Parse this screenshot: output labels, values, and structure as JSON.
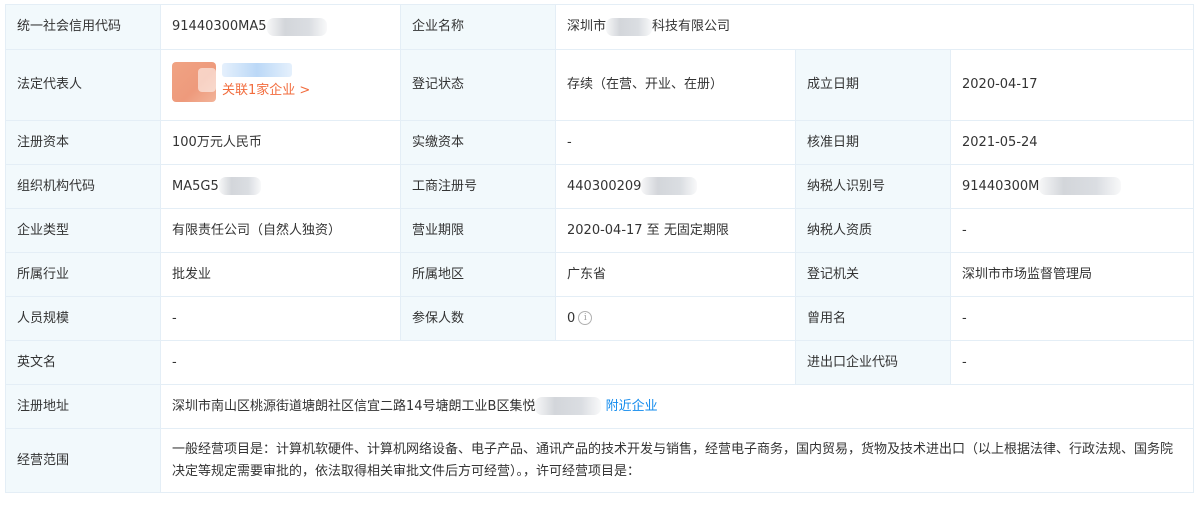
{
  "rows": {
    "r1": {
      "label1": "统一社会信用代码",
      "value1": "91440300MA5",
      "label2": "企业名称",
      "value2_prefix": "深圳市",
      "value2_suffix": "科技有限公司"
    },
    "r2": {
      "label1": "法定代表人",
      "rep_link": "关联1家企业 >",
      "label2": "登记状态",
      "value2": "存续（在营、开业、在册）",
      "label3": "成立日期",
      "value3": "2020-04-17"
    },
    "r3": {
      "label1": "注册资本",
      "value1": "100万元人民币",
      "label2": "实缴资本",
      "value2": "-",
      "label3": "核准日期",
      "value3": "2021-05-24"
    },
    "r4": {
      "label1": "组织机构代码",
      "value1": "MA5G5",
      "label2": "工商注册号",
      "value2": "440300209",
      "label3": "纳税人识别号",
      "value3": "91440300M"
    },
    "r5": {
      "label1": "企业类型",
      "value1": "有限责任公司（自然人独资）",
      "label2": "营业期限",
      "value2": "2020-04-17 至 无固定期限",
      "label3": "纳税人资质",
      "value3": "-"
    },
    "r6": {
      "label1": "所属行业",
      "value1": "批发业",
      "label2": "所属地区",
      "value2": "广东省",
      "label3": "登记机关",
      "value3": "深圳市市场监督管理局"
    },
    "r7": {
      "label1": "人员规模",
      "value1": "-",
      "label2": "参保人数",
      "value2": "0",
      "label3": "曾用名",
      "value3": "-"
    },
    "r8": {
      "label1": "英文名",
      "value1": "-",
      "label3": "进出口企业代码",
      "value3": "-"
    },
    "r9": {
      "label1": "注册地址",
      "value1": "深圳市南山区桃源街道塘朗社区信宜二路14号塘朗工业B区集悦",
      "nearby_link": "附近企业"
    },
    "r10": {
      "label1": "经营范围",
      "value1": "一般经营项目是：计算机软硬件、计算机网络设备、电子产品、通讯产品的技术开发与销售，经营电子商务，国内贸易，货物及技术进出口（以上根据法律、行政法规、国务院决定等规定需要审批的，依法取得相关审批文件后方可经营）。，许可经营项目是："
    }
  },
  "icons": {
    "info": "info-circle-icon",
    "avatar": "avatar-image"
  },
  "colors": {
    "label_bg": "#f2f9fc",
    "border": "#e4eef6",
    "link_blue": "#128bed",
    "link_orange": "#f26c3d",
    "text": "#333333"
  }
}
